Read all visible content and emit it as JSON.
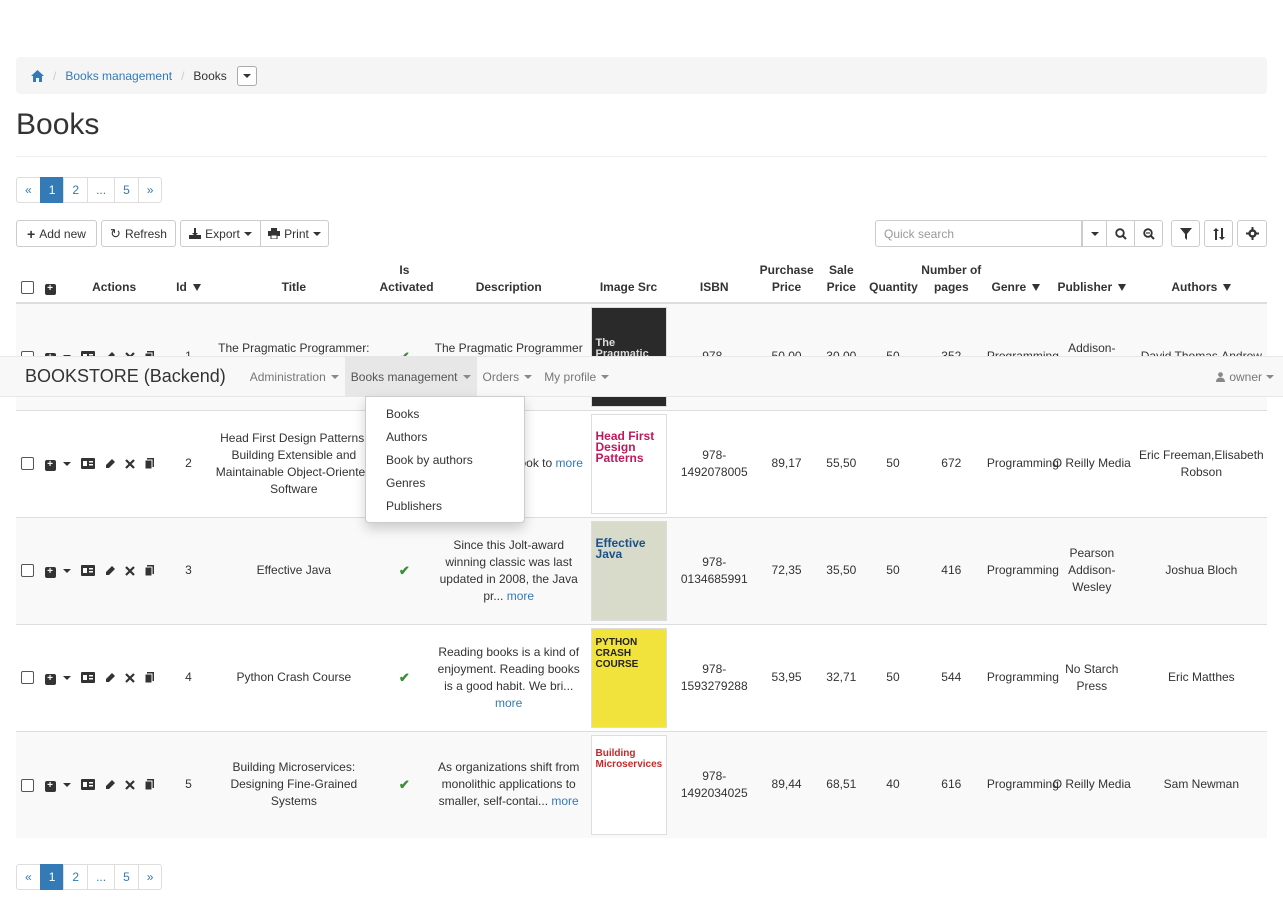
{
  "breadcrumb": {
    "items": [
      "Books management"
    ],
    "current": "Books"
  },
  "page": {
    "title": "Books"
  },
  "pagination": {
    "prev": "«",
    "pages": [
      "1",
      "2",
      "...",
      "5"
    ],
    "next": "»",
    "active": "1"
  },
  "toolbar": {
    "add_new": "Add new",
    "refresh": "Refresh",
    "export": "Export",
    "print": "Print",
    "search_placeholder": "Quick search"
  },
  "table": {
    "headers": {
      "actions": "Actions",
      "id": "Id",
      "title": "Title",
      "is_activated": "Is Activated",
      "description": "Description",
      "image_src": "Image Src",
      "isbn": "ISBN",
      "purchase_price": "Purchase Price",
      "sale_price": "Sale Price",
      "quantity": "Quantity",
      "pages": "Number of pages",
      "genre": "Genre",
      "publisher": "Publisher",
      "authors": "Authors"
    },
    "rows": [
      {
        "id": "1",
        "title": "The Pragmatic Programmer: your journey",
        "desc": "The Pragmatic Programmer is one of",
        "more": "",
        "cover": "The Pragmatic Programmer",
        "cover_color": "#2a2a2a",
        "isbn": "978-",
        "purchase": "50,00",
        "sale": "30,00",
        "qty": "50",
        "pages": "352",
        "genre": "Programming",
        "publisher": "Addison-Wesley",
        "authors": "David Thomas,Andrew"
      },
      {
        "id": "2",
        "title": "Head First Design Patterns: Building Extensible and Maintainable Object-Oriented Software",
        "desc": "u don\\'t ent the look to",
        "more": "more",
        "cover": "Head First Design Patterns",
        "cover_color": "#ffffff",
        "isbn": "978-1492078005",
        "purchase": "89,17",
        "sale": "55,50",
        "qty": "50",
        "pages": "672",
        "genre": "Programming",
        "publisher": "O Reilly Media",
        "authors": "Eric Freeman,Elisabeth Robson"
      },
      {
        "id": "3",
        "title": "Effective Java",
        "desc": "Since this Jolt-award winning classic was last updated in 2008, the Java pr...",
        "more": "more",
        "cover": "Effective Java",
        "cover_color": "#d8dbc9",
        "isbn": "978-0134685991",
        "purchase": "72,35",
        "sale": "35,50",
        "qty": "50",
        "pages": "416",
        "genre": "Programming",
        "publisher": "Pearson Addison-Wesley",
        "authors": "Joshua Bloch"
      },
      {
        "id": "4",
        "title": "Python Crash Course",
        "desc": "Reading books is a kind of enjoyment. Reading books is a good habit. We bri...",
        "more": "more",
        "cover": "PYTHON CRASH COURSE",
        "cover_color": "#f2e23c",
        "isbn": "978-1593279288",
        "purchase": "53,95",
        "sale": "32,71",
        "qty": "50",
        "pages": "544",
        "genre": "Programming",
        "publisher": "No Starch Press",
        "authors": "Eric Matthes"
      },
      {
        "id": "5",
        "title": "Building Microservices: Designing Fine-Grained Systems",
        "desc": "As organizations shift from monolithic applications to smaller, self-contai...",
        "more": "more",
        "cover": "Building Microservices",
        "cover_color": "#ffffff",
        "isbn": "978-1492034025",
        "purchase": "89,44",
        "sale": "68,51",
        "qty": "40",
        "pages": "616",
        "genre": "Programming",
        "publisher": "O Reilly Media",
        "authors": "Sam Newman"
      }
    ]
  },
  "navbar": {
    "brand": "BOOKSTORE (Backend)",
    "items": [
      "Administration",
      "Books management",
      "Orders",
      "My profile"
    ],
    "user": "owner"
  },
  "dropdown": {
    "items": [
      "Books",
      "Authors",
      "Book by authors",
      "Genres",
      "Publishers"
    ]
  }
}
